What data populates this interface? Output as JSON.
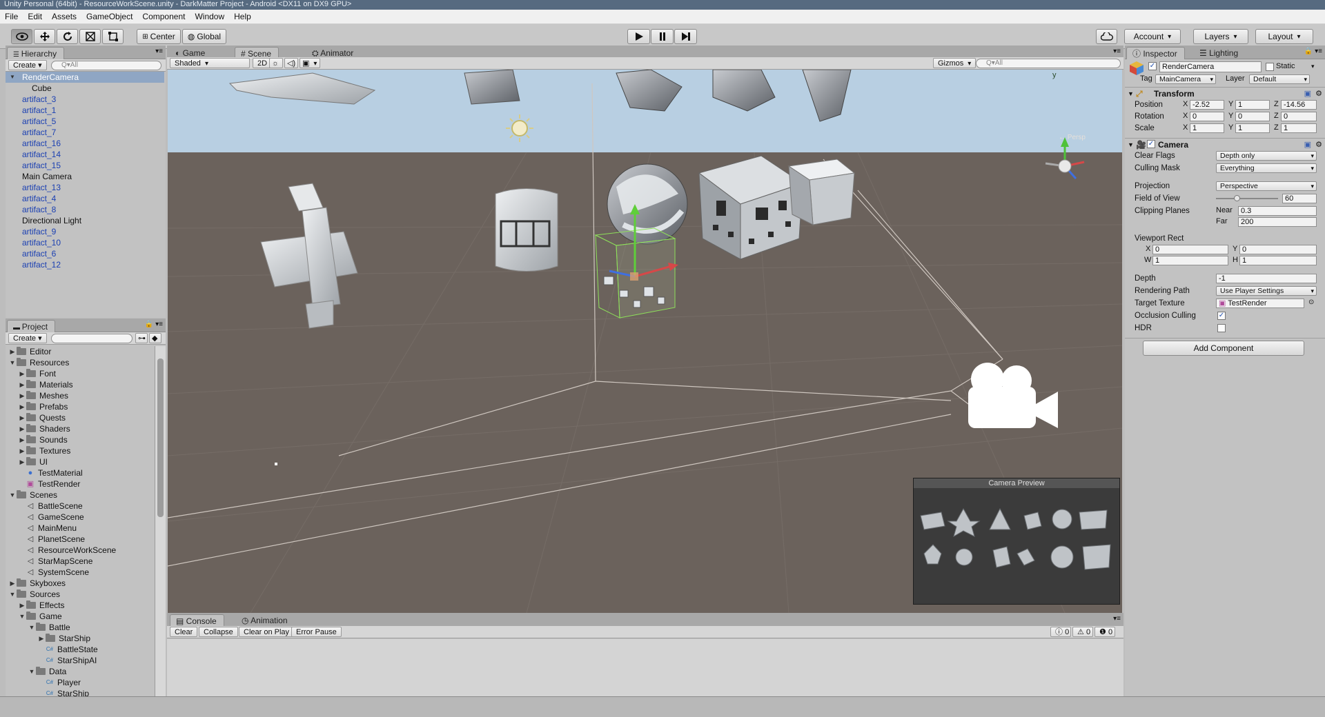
{
  "window": {
    "title": "Unity Personal (64bit) - ResourceWorkScene.unity - DarkMatter Project - Android <DX11 on DX9 GPU>"
  },
  "menu": [
    "File",
    "Edit",
    "Assets",
    "GameObject",
    "Component",
    "Window",
    "Help"
  ],
  "toolbar": {
    "pivot": "Center",
    "space": "Global",
    "account": "Account",
    "layers": "Layers",
    "layout": "Layout"
  },
  "hierarchy": {
    "tab": "Hierarchy",
    "create": "Create",
    "search_placeholder": "Q▾All",
    "items": [
      {
        "label": "RenderCamera",
        "selected": true,
        "prefab": false,
        "indent": 0
      },
      {
        "label": "Cube",
        "selected": false,
        "prefab": false,
        "indent": 1
      },
      {
        "label": "artifact_3",
        "prefab": true
      },
      {
        "label": "artifact_1",
        "prefab": true
      },
      {
        "label": "artifact_5",
        "prefab": true
      },
      {
        "label": "artifact_7",
        "prefab": true
      },
      {
        "label": "artifact_16",
        "prefab": true
      },
      {
        "label": "artifact_14",
        "prefab": true
      },
      {
        "label": "artifact_15",
        "prefab": true
      },
      {
        "label": "Main Camera",
        "prefab": false
      },
      {
        "label": "artifact_13",
        "prefab": true
      },
      {
        "label": "artifact_4",
        "prefab": true
      },
      {
        "label": "artifact_8",
        "prefab": true
      },
      {
        "label": "Directional Light",
        "prefab": false
      },
      {
        "label": "artifact_9",
        "prefab": true
      },
      {
        "label": "artifact_10",
        "prefab": true
      },
      {
        "label": "artifact_6",
        "prefab": true
      },
      {
        "label": "artifact_12",
        "prefab": true
      }
    ]
  },
  "project": {
    "tab": "Project",
    "create": "Create",
    "items": [
      {
        "label": "Editor",
        "depth": 0,
        "open": false,
        "type": "folder"
      },
      {
        "label": "Resources",
        "depth": 0,
        "open": true,
        "type": "folder"
      },
      {
        "label": "Font",
        "depth": 1,
        "open": false,
        "type": "folder"
      },
      {
        "label": "Materials",
        "depth": 1,
        "open": false,
        "type": "folder"
      },
      {
        "label": "Meshes",
        "depth": 1,
        "open": false,
        "type": "folder"
      },
      {
        "label": "Prefabs",
        "depth": 1,
        "open": false,
        "type": "folder"
      },
      {
        "label": "Quests",
        "depth": 1,
        "open": false,
        "type": "folder"
      },
      {
        "label": "Shaders",
        "depth": 1,
        "open": false,
        "type": "folder"
      },
      {
        "label": "Sounds",
        "depth": 1,
        "open": false,
        "type": "folder"
      },
      {
        "label": "Textures",
        "depth": 1,
        "open": false,
        "type": "folder"
      },
      {
        "label": "UI",
        "depth": 1,
        "open": false,
        "type": "folder"
      },
      {
        "label": "TestMaterial",
        "depth": 1,
        "type": "material"
      },
      {
        "label": "TestRender",
        "depth": 1,
        "type": "texture"
      },
      {
        "label": "Scenes",
        "depth": 0,
        "open": true,
        "type": "folder"
      },
      {
        "label": "BattleScene",
        "depth": 1,
        "type": "scene"
      },
      {
        "label": "GameScene",
        "depth": 1,
        "type": "scene"
      },
      {
        "label": "MainMenu",
        "depth": 1,
        "type": "scene"
      },
      {
        "label": "PlanetScene",
        "depth": 1,
        "type": "scene"
      },
      {
        "label": "ResourceWorkScene",
        "depth": 1,
        "type": "scene"
      },
      {
        "label": "StarMapScene",
        "depth": 1,
        "type": "scene"
      },
      {
        "label": "SystemScene",
        "depth": 1,
        "type": "scene"
      },
      {
        "label": "Skyboxes",
        "depth": 0,
        "open": false,
        "type": "folder"
      },
      {
        "label": "Sources",
        "depth": 0,
        "open": true,
        "type": "folder"
      },
      {
        "label": "Effects",
        "depth": 1,
        "open": false,
        "type": "folder"
      },
      {
        "label": "Game",
        "depth": 1,
        "open": true,
        "type": "folder"
      },
      {
        "label": "Battle",
        "depth": 2,
        "open": true,
        "type": "folder"
      },
      {
        "label": "StarShip",
        "depth": 3,
        "open": false,
        "type": "folder"
      },
      {
        "label": "BattleState",
        "depth": 3,
        "type": "script"
      },
      {
        "label": "StarShipAI",
        "depth": 3,
        "type": "script"
      },
      {
        "label": "Data",
        "depth": 2,
        "open": true,
        "type": "folder"
      },
      {
        "label": "Player",
        "depth": 3,
        "type": "script"
      },
      {
        "label": "StarShip",
        "depth": 3,
        "type": "script"
      }
    ]
  },
  "scene": {
    "tabs": [
      "Game",
      "Scene",
      "Animator"
    ],
    "active_tab": "Scene",
    "shading": "Shaded",
    "mode_2d": "2D",
    "gizmos": "Gizmos",
    "search_placeholder": "Q▾All",
    "persp_label": "← Persp",
    "gizmo_axis_y": "y",
    "camera_preview_title": "Camera Preview"
  },
  "console": {
    "tabs": [
      "Console",
      "Animation"
    ],
    "buttons": [
      "Clear",
      "Collapse",
      "Clear on Play",
      "Error Pause"
    ],
    "counts": {
      "info": "0",
      "warnings": "0",
      "errors": "0"
    }
  },
  "inspector": {
    "tabs": [
      "Inspector",
      "Lighting"
    ],
    "object_name": "RenderCamera",
    "static_label": "Static",
    "tag_label": "Tag",
    "tag": "MainCamera",
    "layer_label": "Layer",
    "layer": "Default",
    "transform": {
      "title": "Transform",
      "position_label": "Position",
      "rotation_label": "Rotation",
      "scale_label": "Scale",
      "position": {
        "x": "-2.52",
        "y": "1",
        "z": "-14.56"
      },
      "rotation": {
        "x": "0",
        "y": "0",
        "z": "0"
      },
      "scale": {
        "x": "1",
        "y": "1",
        "z": "1"
      }
    },
    "camera": {
      "title": "Camera",
      "clear_flags_label": "Clear Flags",
      "clear_flags": "Depth only",
      "culling_mask_label": "Culling Mask",
      "culling_mask": "Everything",
      "projection_label": "Projection",
      "projection": "Perspective",
      "fov_label": "Field of View",
      "fov": "60",
      "fov_fraction": 0.33,
      "clipping_label": "Clipping Planes",
      "near_label": "Near",
      "near": "0.3",
      "far_label": "Far",
      "far": "200",
      "viewport_label": "Viewport Rect",
      "vp": {
        "x": "0",
        "y": "0",
        "w": "1",
        "h": "1"
      },
      "depth_label": "Depth",
      "depth": "-1",
      "rendering_path_label": "Rendering Path",
      "rendering_path": "Use Player Settings",
      "target_texture_label": "Target Texture",
      "target_texture": "TestRender",
      "occlusion_label": "Occlusion Culling",
      "occlusion": true,
      "hdr_label": "HDR",
      "hdr": false
    },
    "add_component": "Add Component"
  }
}
